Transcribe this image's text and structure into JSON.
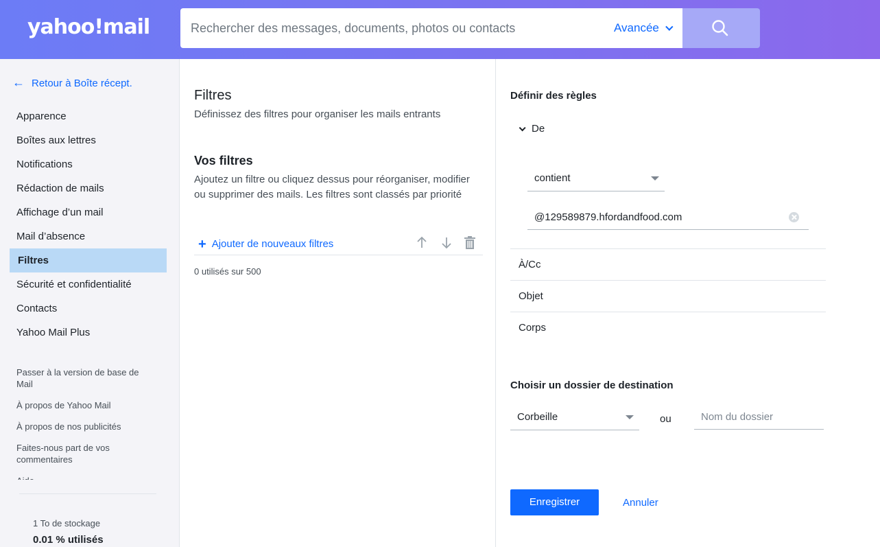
{
  "header": {
    "logo": "yahoo!mail",
    "search_placeholder": "Rechercher des messages, documents, photos ou contacts",
    "advanced_label": "Avancée"
  },
  "sidebar": {
    "back_label": "Retour à Boîte récept.",
    "items": [
      {
        "label": "Apparence"
      },
      {
        "label": "Boîtes aux lettres"
      },
      {
        "label": "Notifications"
      },
      {
        "label": "Rédaction de mails"
      },
      {
        "label": "Affichage d’un mail"
      },
      {
        "label": "Mail d’absence"
      },
      {
        "label": "Filtres"
      },
      {
        "label": "Sécurité et confidentialité"
      },
      {
        "label": "Contacts"
      },
      {
        "label": "Yahoo Mail Plus"
      }
    ],
    "secondary": [
      {
        "label": "Passer à la version de base de Mail"
      },
      {
        "label": "À propos de Yahoo Mail"
      },
      {
        "label": "À propos de nos publicités"
      },
      {
        "label": "Faites-nous part de vos commentaires"
      },
      {
        "label": "Aide"
      }
    ],
    "storage": {
      "total": "1 To de stockage",
      "used": "0.01 % utilisés"
    }
  },
  "filters": {
    "title": "Filtres",
    "subtitle": "Définissez des filtres pour organiser les mails entrants",
    "your_filters_title": "Vos filtres",
    "your_filters_desc": "Ajoutez un filtre ou cliquez dessus pour réorganiser, modifier ou supprimer des mails. Les filtres sont classés par priorité",
    "add_label": "Ajouter de nouveaux filtres",
    "usage": "0 utilisés sur 500"
  },
  "rules": {
    "title": "Définir des règles",
    "from_label": "De",
    "condition_value": "contient",
    "from_value": "@129589879.hfordandfood.com",
    "to_label": "À/Cc",
    "subject_label": "Objet",
    "body_label": "Corps"
  },
  "destination": {
    "title": "Choisir un dossier de destination",
    "folder_value": "Corbeille",
    "or_label": "ou",
    "folder_name_placeholder": "Nom du dossier"
  },
  "actions": {
    "save_label": "Enregistrer",
    "cancel_label": "Annuler"
  },
  "colors": {
    "accent": "#0f69ff",
    "active_nav": "#b9d9f6"
  }
}
